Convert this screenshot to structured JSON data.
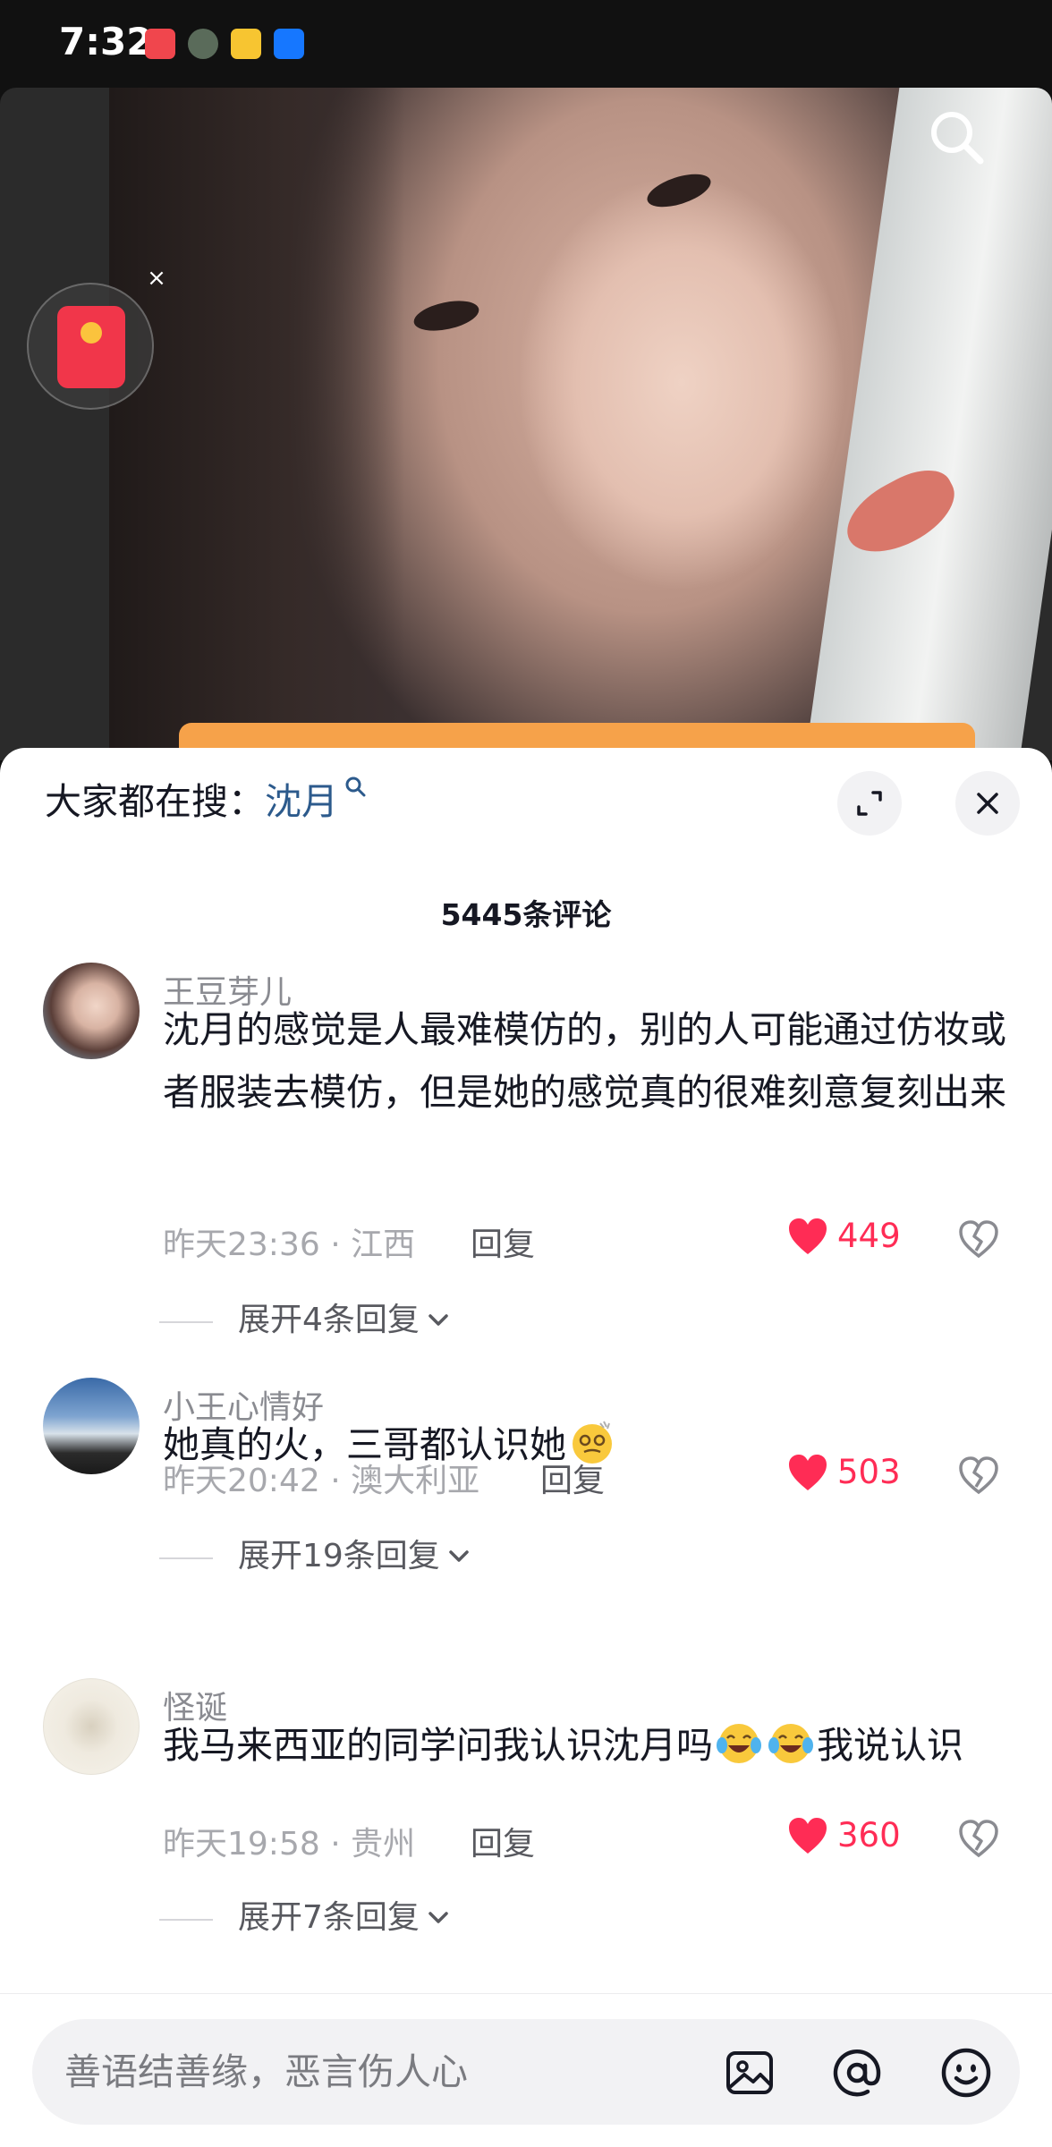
{
  "status_bar": {
    "time": "7:32"
  },
  "search_hint": {
    "label": "大家都在搜：",
    "keyword": "沈月"
  },
  "comments_header": {
    "count_label": "5445条评论"
  },
  "comments": [
    {
      "author": "王豆芽儿",
      "text": "沈月的感觉是人最难模仿的，别的人可能通过仿妆或者服装去模仿，但是她的感觉真的很难刻意复刻出来",
      "time": "昨天23:36",
      "location": "江西",
      "reply_label": "回复",
      "likes": "449",
      "expand_label": "展开4条回复"
    },
    {
      "author": "小王心情好",
      "text": "她真的火，三哥都认识她",
      "time": "昨天20:42",
      "location": "澳大利亚",
      "reply_label": "回复",
      "likes": "503",
      "expand_label": "展开19条回复"
    },
    {
      "author": "怪诞",
      "text_part1": "我马来西亚的同学问我认识沈月吗",
      "text_part2": "我说认识",
      "time": "昨天19:58",
      "location": "贵州",
      "reply_label": "回复",
      "likes": "360",
      "expand_label": "展开7条回复"
    }
  ],
  "input_bar": {
    "placeholder": "善语结善缘，恶言伤人心"
  },
  "colors": {
    "like": "#ff2c55",
    "keyword": "#2c5a8c",
    "redpacket": "#f1364a"
  },
  "icons": [
    "search-icon",
    "red-packet-icon",
    "close-icon",
    "expand-icon",
    "heart-icon",
    "broken-heart-icon",
    "chevron-down-icon",
    "image-icon",
    "at-icon",
    "emoji-icon"
  ]
}
